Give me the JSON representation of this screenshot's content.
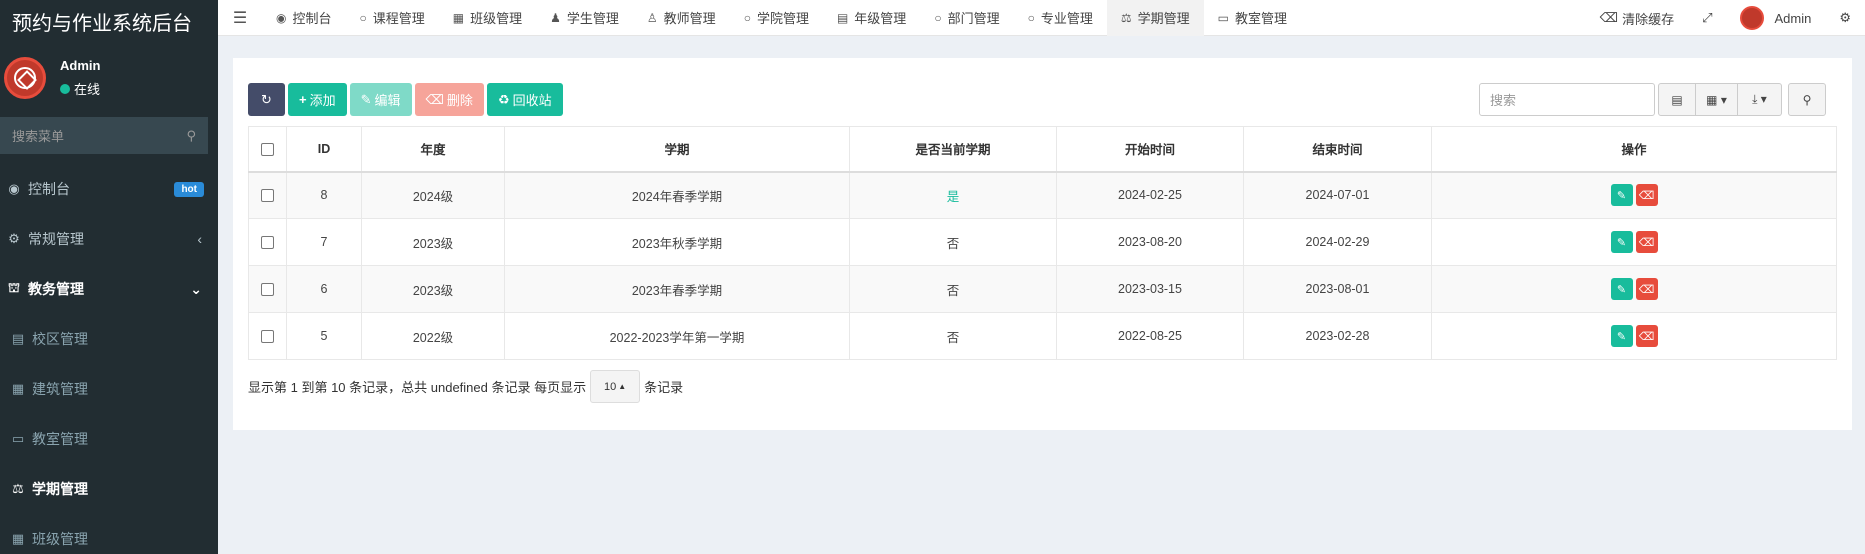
{
  "app": {
    "title": "预约与作业系统后台"
  },
  "user": {
    "name": "Admin",
    "status": "在线"
  },
  "sidebar": {
    "search_placeholder": "搜索菜单",
    "items": [
      {
        "label": "控制台",
        "badge": "hot"
      },
      {
        "label": "常规管理"
      },
      {
        "label": "教务管理"
      },
      {
        "label": "校区管理"
      },
      {
        "label": "建筑管理"
      },
      {
        "label": "教室管理"
      },
      {
        "label": "学期管理"
      },
      {
        "label": "班级管理"
      }
    ]
  },
  "topnav": {
    "tabs": [
      "控制台",
      "课程管理",
      "班级管理",
      "学生管理",
      "教师管理",
      "学院管理",
      "年级管理",
      "部门管理",
      "专业管理",
      "学期管理",
      "教室管理"
    ],
    "clear_cache": "清除缓存",
    "admin": "Admin"
  },
  "toolbar": {
    "add": "添加",
    "edit": "编辑",
    "delete": "删除",
    "recycle": "回收站",
    "search_placeholder": "搜索"
  },
  "table": {
    "headers": [
      "ID",
      "年度",
      "学期",
      "是否当前学期",
      "开始时间",
      "结束时间",
      "操作"
    ],
    "rows": [
      {
        "id": "8",
        "year": "2024级",
        "term": "2024年春季学期",
        "current": "是",
        "start": "2024-02-25",
        "end": "2024-07-01"
      },
      {
        "id": "7",
        "year": "2023级",
        "term": "2023年秋季学期",
        "current": "否",
        "start": "2023-08-20",
        "end": "2024-02-29"
      },
      {
        "id": "6",
        "year": "2023级",
        "term": "2023年春季学期",
        "current": "否",
        "start": "2023-03-15",
        "end": "2023-08-01"
      },
      {
        "id": "5",
        "year": "2022级",
        "term": "2022-2023学年第一学期",
        "current": "否",
        "start": "2022-08-25",
        "end": "2023-02-28"
      }
    ]
  },
  "footer": {
    "summary": "显示第 1 到第 10 条记录，总共 undefined 条记录 每页显示",
    "page_size": "10",
    "suffix": "条记录"
  },
  "colors": {
    "sidebar_bg": "#222d32",
    "success": "#18bc9c",
    "danger": "#e74c3c",
    "primary_dark": "#444c69"
  }
}
